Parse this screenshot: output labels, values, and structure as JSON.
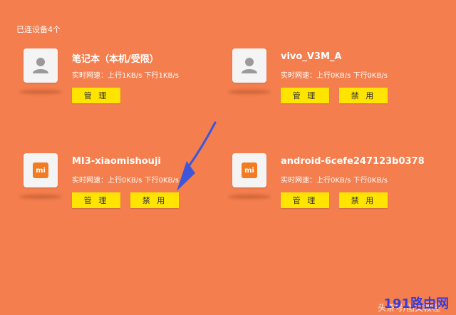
{
  "header": {
    "connected_count": "已连设备4个"
  },
  "common": {
    "speed_label": "实时网速：",
    "manage_label": "管 理",
    "disable_label": "禁 用"
  },
  "devices": [
    {
      "name": "笔记本（本机/受限）",
      "up": "上行1KB/s",
      "down": "下行1KB/s",
      "icon": "person-icon"
    },
    {
      "name": "vivo_V3M_A",
      "up": "上行0KB/s",
      "down": "下行0KB/s",
      "icon": "person-icon"
    },
    {
      "name": "MI3-xiaomishouji",
      "up": "上行0KB/s",
      "down": "下行0KB/s",
      "icon": "mi-logo-icon"
    },
    {
      "name": "android-6cefe247123b0378",
      "up": "上行0KB/s",
      "down": "下行0KB/s",
      "icon": "mi-logo-icon"
    }
  ],
  "watermark": {
    "site": "191路由网",
    "sub": "头条号/图文教程"
  },
  "colors": {
    "background": "#F47E4E",
    "button": "#FFE400",
    "arrow": "#3D57D8",
    "mi": "#F37B21"
  },
  "mi_label": "mi"
}
